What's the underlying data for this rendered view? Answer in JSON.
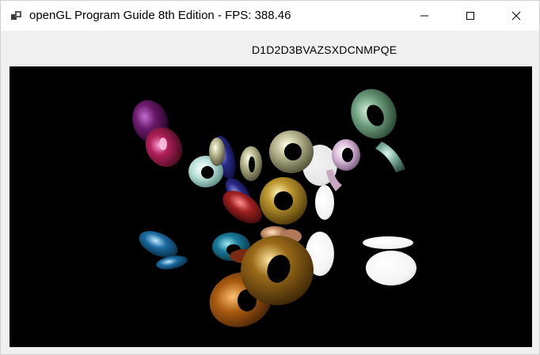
{
  "window": {
    "title": "openGL Program Guide 8th Edition - FPS: 388.46",
    "controls": [
      "minimize",
      "maximize",
      "close"
    ]
  },
  "status_label": "D1D2D3BVAZSXDCNMPQE",
  "viewport": {
    "background": "#000000",
    "content": "3D rendered tori scene",
    "tori_colors": [
      "#7a1040",
      "#2a2a8a",
      "#c8c8a0",
      "#cfe8e0",
      "#b89ac0",
      "#6a9a7a",
      "#ffffff",
      "#1a6aa0",
      "#c09020",
      "#a02020",
      "#b06010",
      "#1a7a9a"
    ]
  }
}
